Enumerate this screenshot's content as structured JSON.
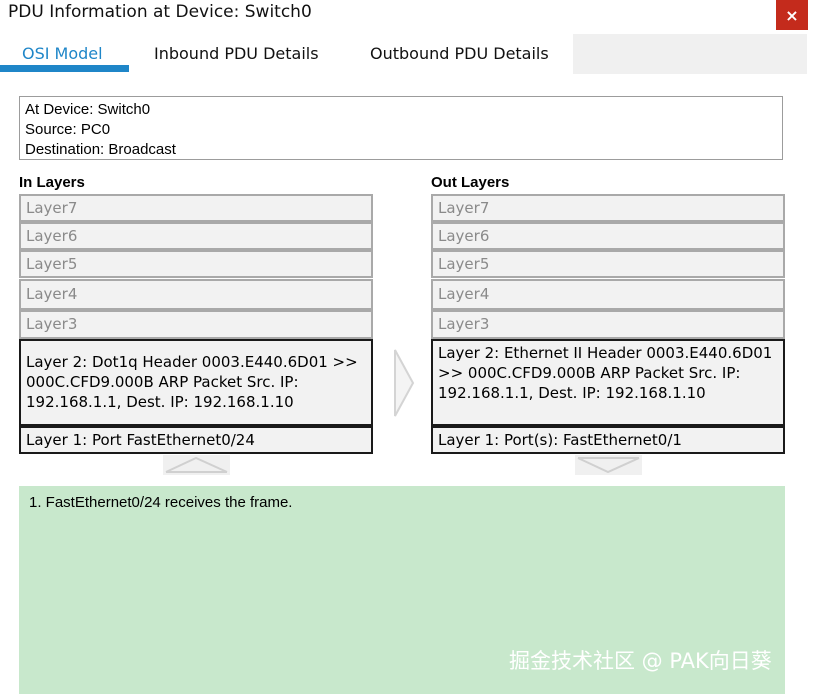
{
  "window": {
    "title": "PDU Information at Device: Switch0",
    "close_glyph": "×"
  },
  "tabs": [
    {
      "label": "OSI Model",
      "active": true
    },
    {
      "label": "Inbound PDU Details",
      "active": false
    },
    {
      "label": "Outbound PDU Details",
      "active": false
    }
  ],
  "info": {
    "device": "At Device: Switch0",
    "source": "Source: PC0",
    "destination": "Destination: Broadcast"
  },
  "in_layers": {
    "header": "In Layers",
    "layer7": "Layer7",
    "layer6": "Layer6",
    "layer5": "Layer5",
    "layer4": "Layer4",
    "layer3": "Layer3",
    "layer2": "Layer 2: Dot1q Header 0003.E440.6D01 >> 000C.CFD9.000B ARP Packet Src. IP: 192.168.1.1, Dest. IP: 192.168.1.10",
    "layer1": "Layer 1: Port FastEthernet0/24"
  },
  "out_layers": {
    "header": "Out Layers",
    "layer7": "Layer7",
    "layer6": "Layer6",
    "layer5": "Layer5",
    "layer4": "Layer4",
    "layer3": "Layer3",
    "layer2": "Layer 2: Ethernet II Header 0003.E440.6D01 >> 000C.CFD9.000B ARP Packet Src. IP: 192.168.1.1, Dest. IP: 192.168.1.10",
    "layer1": "Layer 1: Port(s): FastEthernet0/1"
  },
  "explanation": {
    "step1": "1. FastEthernet0/24 receives the frame."
  },
  "watermark": "掘金技术社区 @ PAK向日葵",
  "colors": {
    "accent": "#1f86c8",
    "close": "#c42b1c",
    "explain_bg": "#c8e8cc"
  },
  "icons": {
    "close": "close-icon",
    "arrow_right": "chevron-right-icon",
    "arrow_up": "chevron-up-icon",
    "arrow_down": "chevron-down-icon"
  }
}
